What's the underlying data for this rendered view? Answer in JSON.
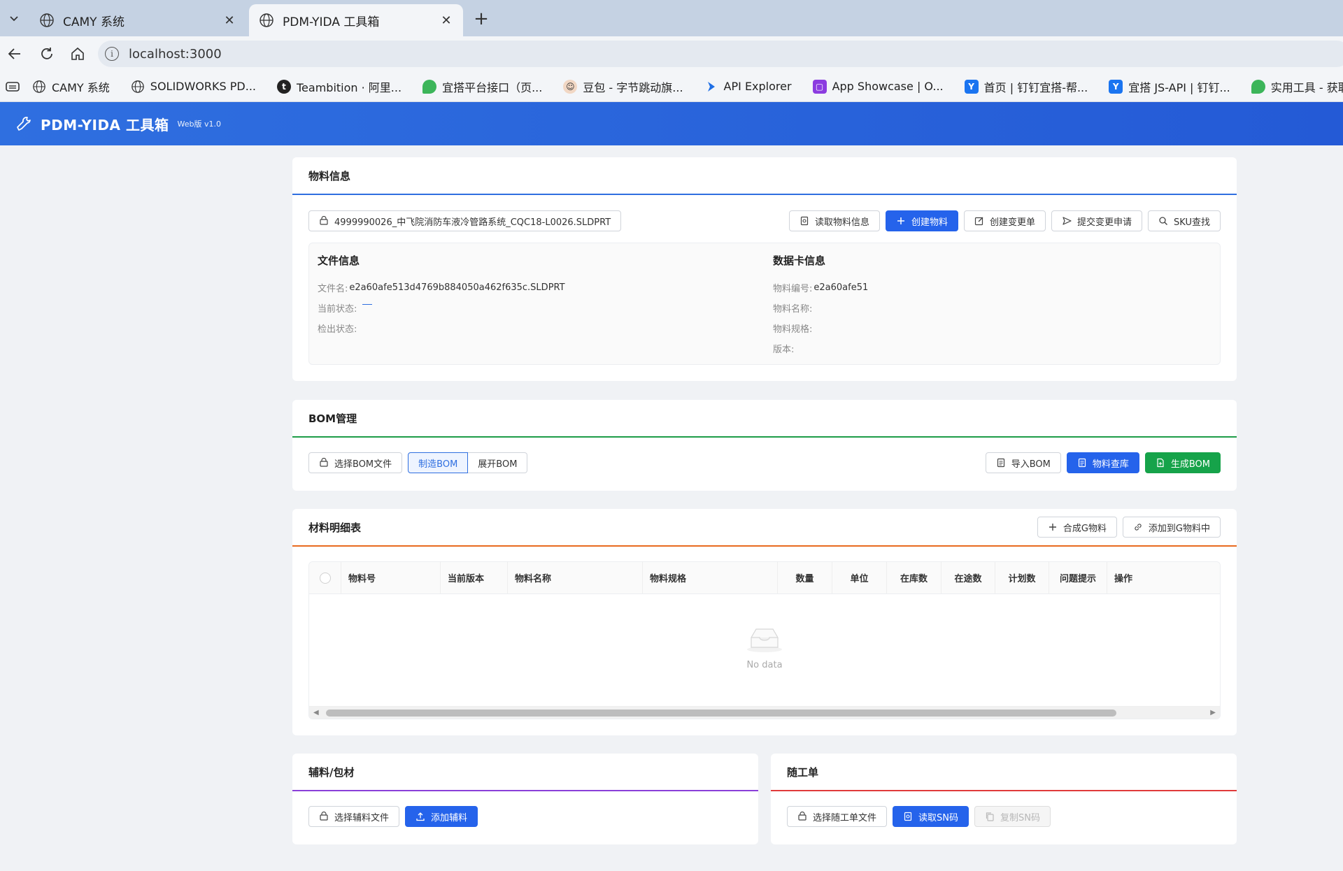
{
  "browser": {
    "tabs": [
      {
        "title": "CAMY 系统",
        "active": false
      },
      {
        "title": "PDM-YIDA 工具箱",
        "active": true
      }
    ],
    "url": "localhost:3000",
    "bookmarks": [
      {
        "label": "CAMY 系统",
        "icon": "globe-icon"
      },
      {
        "label": "SOLIDWORKS PD...",
        "icon": "globe-icon"
      },
      {
        "label": "Teambition · 阿里...",
        "icon": "teambition-icon"
      },
      {
        "label": "宜搭平台接口（页...",
        "icon": "yida-icon"
      },
      {
        "label": "豆包 - 字节跳动旗...",
        "icon": "doubao-icon"
      },
      {
        "label": "API Explorer",
        "icon": "api-icon"
      },
      {
        "label": "App Showcase | O...",
        "icon": "app-showcase-icon"
      },
      {
        "label": "首页 | 钉钉宜搭-帮...",
        "icon": "dingtalk-icon"
      },
      {
        "label": "宜搭 JS-API | 钉钉...",
        "icon": "dingtalk-icon"
      },
      {
        "label": "实用工具 - 获取登...",
        "icon": "yida-icon"
      }
    ]
  },
  "app": {
    "title": "PDM-YIDA 工具箱",
    "version": "Web版 v1.0"
  },
  "material": {
    "heading": "物料信息",
    "file_button": "4999990026_中飞院消防车液冷管路系统_CQC18-L0026.SLDPRT",
    "actions": {
      "read": "读取物料信息",
      "create": "创建物料",
      "change": "创建变更单",
      "submit": "提交变更申请",
      "sku": "SKU查找"
    },
    "file_info": {
      "heading": "文件信息",
      "filename_label": "文件名:",
      "filename_value": "e2a60afe513d4769b884050a462f635c.SLDPRT",
      "state_label": "当前状态:",
      "state_value": "",
      "checkout_label": "检出状态:",
      "checkout_value": ""
    },
    "card_info": {
      "heading": "数据卡信息",
      "code_label": "物料编号:",
      "code_value": "e2a60afe51",
      "name_label": "物料名称:",
      "name_value": "",
      "spec_label": "物料规格:",
      "spec_value": "",
      "ver_label": "版本:",
      "ver_value": ""
    }
  },
  "bom": {
    "heading": "BOM管理",
    "select_file": "选择BOM文件",
    "seg_manufacture": "制造BOM",
    "seg_expand": "展开BOM",
    "import": "导入BOM",
    "library": "物料查库",
    "generate": "生成BOM"
  },
  "detail": {
    "heading": "材料明细表",
    "merge": "合成G物料",
    "add_to": "添加到G物料中",
    "columns": [
      "物料号",
      "当前版本",
      "物料名称",
      "物料规格",
      "数量",
      "单位",
      "在库数",
      "在途数",
      "计划数",
      "问题提示",
      "操作"
    ],
    "empty_text": "No data"
  },
  "aux": {
    "heading": "辅料/包材",
    "select_file": "选择辅料文件",
    "add": "添加辅料"
  },
  "workorder": {
    "heading": "随工单",
    "select_file": "选择随工单文件",
    "read_sn": "读取SN码",
    "copy_sn": "复制SN码"
  }
}
